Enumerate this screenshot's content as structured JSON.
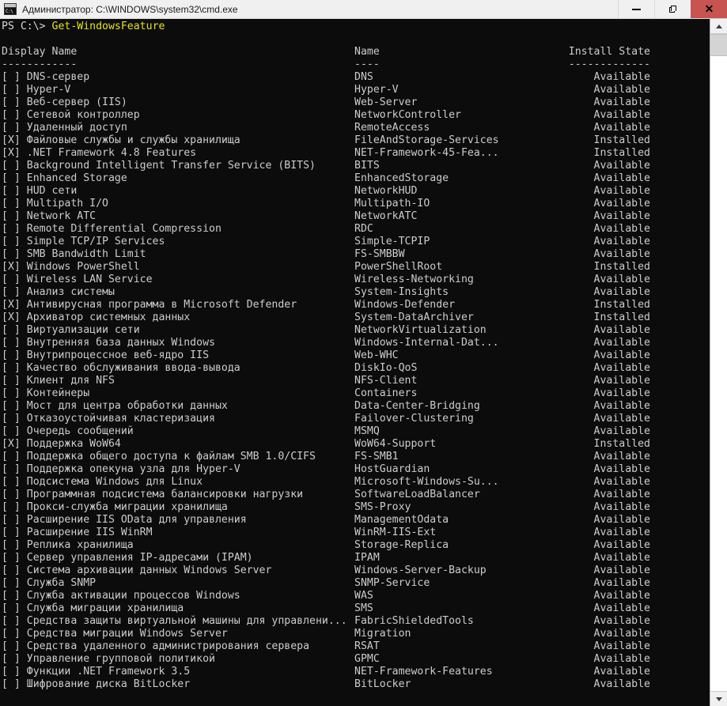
{
  "window": {
    "title": "Администратор: C:\\WINDOWS\\system32\\cmd.exe",
    "icon": "cmd-console-icon",
    "icon_text": "C:\\",
    "colors": {
      "titlebar_bg": "#f0f0f0",
      "close_bg": "#c75450",
      "console_bg": "#0c0c0c",
      "console_fg": "#cccccc",
      "prompt_command_fg": "#e5e510"
    },
    "buttons": {
      "minimize": "minimize-button",
      "maximize": "restore-button",
      "close": "close-button",
      "close_label": "✕"
    }
  },
  "console": {
    "prompt_prefix": "PS C:\\> ",
    "command": "Get-WindowsFeature",
    "headers": {
      "display_name": "Display Name",
      "name": "Name",
      "install_state": "Install State"
    },
    "rules": {
      "display_name": "------------",
      "name": "----",
      "install_state": "-------------"
    },
    "rows": [
      {
        "mark": "[ ]",
        "display": "DNS-сервер",
        "name": "DNS",
        "state": "Available"
      },
      {
        "mark": "[ ]",
        "display": "Hyper-V",
        "name": "Hyper-V",
        "state": "Available"
      },
      {
        "mark": "[ ]",
        "display": "Веб-сервер (IIS)",
        "name": "Web-Server",
        "state": "Available"
      },
      {
        "mark": "[ ]",
        "display": "Сетевой контроллер",
        "name": "NetworkController",
        "state": "Available"
      },
      {
        "mark": "[ ]",
        "display": "Удаленный доступ",
        "name": "RemoteAccess",
        "state": "Available"
      },
      {
        "mark": "[X]",
        "display": "Файловые службы и службы хранилища",
        "name": "FileAndStorage-Services",
        "state": "Installed"
      },
      {
        "mark": "[X]",
        "display": ".NET Framework 4.8 Features",
        "name": "NET-Framework-45-Fea...",
        "state": "Installed"
      },
      {
        "mark": "[ ]",
        "display": "Background Intelligent Transfer Service (BITS)",
        "name": "BITS",
        "state": "Available"
      },
      {
        "mark": "[ ]",
        "display": "Enhanced Storage",
        "name": "EnhancedStorage",
        "state": "Available"
      },
      {
        "mark": "[ ]",
        "display": "HUD сети",
        "name": "NetworkHUD",
        "state": "Available"
      },
      {
        "mark": "[ ]",
        "display": "Multipath I/O",
        "name": "Multipath-IO",
        "state": "Available"
      },
      {
        "mark": "[ ]",
        "display": "Network ATC",
        "name": "NetworkATC",
        "state": "Available"
      },
      {
        "mark": "[ ]",
        "display": "Remote Differential Compression",
        "name": "RDC",
        "state": "Available"
      },
      {
        "mark": "[ ]",
        "display": "Simple TCP/IP Services",
        "name": "Simple-TCPIP",
        "state": "Available"
      },
      {
        "mark": "[ ]",
        "display": "SMB Bandwidth Limit",
        "name": "FS-SMBBW",
        "state": "Available"
      },
      {
        "mark": "[X]",
        "display": "Windows PowerShell",
        "name": "PowerShellRoot",
        "state": "Installed"
      },
      {
        "mark": "[ ]",
        "display": "Wireless LAN Service",
        "name": "Wireless-Networking",
        "state": "Available"
      },
      {
        "mark": "[ ]",
        "display": "Анализ системы",
        "name": "System-Insights",
        "state": "Available"
      },
      {
        "mark": "[X]",
        "display": "Антивирусная программа в Microsoft Defender",
        "name": "Windows-Defender",
        "state": "Installed"
      },
      {
        "mark": "[X]",
        "display": "Архиватор системных данных",
        "name": "System-DataArchiver",
        "state": "Installed"
      },
      {
        "mark": "[ ]",
        "display": "Виртуализации сети",
        "name": "NetworkVirtualization",
        "state": "Available"
      },
      {
        "mark": "[ ]",
        "display": "Внутренняя база данных Windows",
        "name": "Windows-Internal-Dat...",
        "state": "Available"
      },
      {
        "mark": "[ ]",
        "display": "Внутрипроцессное веб-ядро IIS",
        "name": "Web-WHC",
        "state": "Available"
      },
      {
        "mark": "[ ]",
        "display": "Качество обслуживания ввода-вывода",
        "name": "DiskIo-QoS",
        "state": "Available"
      },
      {
        "mark": "[ ]",
        "display": "Клиент для NFS",
        "name": "NFS-Client",
        "state": "Available"
      },
      {
        "mark": "[ ]",
        "display": "Контейнеры",
        "name": "Containers",
        "state": "Available"
      },
      {
        "mark": "[ ]",
        "display": "Мост для центра обработки данных",
        "name": "Data-Center-Bridging",
        "state": "Available"
      },
      {
        "mark": "[ ]",
        "display": "Отказоустойчивая кластеризация",
        "name": "Failover-Clustering",
        "state": "Available"
      },
      {
        "mark": "[ ]",
        "display": "Очередь сообщений",
        "name": "MSMQ",
        "state": "Available"
      },
      {
        "mark": "[X]",
        "display": "Поддержка WoW64",
        "name": "WoW64-Support",
        "state": "Installed"
      },
      {
        "mark": "[ ]",
        "display": "Поддержка общего доступа к файлам SMB 1.0/CIFS",
        "name": "FS-SMB1",
        "state": "Available"
      },
      {
        "mark": "[ ]",
        "display": "Поддержка опекуна узла для Hyper-V",
        "name": "HostGuardian",
        "state": "Available"
      },
      {
        "mark": "[ ]",
        "display": "Подсистема Windows для Linux",
        "name": "Microsoft-Windows-Su...",
        "state": "Available"
      },
      {
        "mark": "[ ]",
        "display": "Программная подсистема балансировки нагрузки",
        "name": "SoftwareLoadBalancer",
        "state": "Available"
      },
      {
        "mark": "[ ]",
        "display": "Прокси-служба миграции хранилища",
        "name": "SMS-Proxy",
        "state": "Available"
      },
      {
        "mark": "[ ]",
        "display": "Расширение IIS OData для управления",
        "name": "ManagementOdata",
        "state": "Available"
      },
      {
        "mark": "[ ]",
        "display": "Расширение IIS WinRM",
        "name": "WinRM-IIS-Ext",
        "state": "Available"
      },
      {
        "mark": "[ ]",
        "display": "Реплика хранилища",
        "name": "Storage-Replica",
        "state": "Available"
      },
      {
        "mark": "[ ]",
        "display": "Сервер управления IP-адресами (IPAM)",
        "name": "IPAM",
        "state": "Available"
      },
      {
        "mark": "[ ]",
        "display": "Система архивации данных Windows Server",
        "name": "Windows-Server-Backup",
        "state": "Available"
      },
      {
        "mark": "[ ]",
        "display": "Служба SNMP",
        "name": "SNMP-Service",
        "state": "Available"
      },
      {
        "mark": "[ ]",
        "display": "Служба активации процессов Windows",
        "name": "WAS",
        "state": "Available"
      },
      {
        "mark": "[ ]",
        "display": "Служба миграции хранилища",
        "name": "SMS",
        "state": "Available"
      },
      {
        "mark": "[ ]",
        "display": "Средства защиты виртуальной машины для управлени...",
        "name": "FabricShieldedTools",
        "state": "Available"
      },
      {
        "mark": "[ ]",
        "display": "Средства миграции Windows Server",
        "name": "Migration",
        "state": "Available"
      },
      {
        "mark": "[ ]",
        "display": "Средства удаленного администрирования сервера",
        "name": "RSAT",
        "state": "Available"
      },
      {
        "mark": "[ ]",
        "display": "Управление групповой политикой",
        "name": "GPMC",
        "state": "Available"
      },
      {
        "mark": "[ ]",
        "display": "Функции .NET Framework 3.5",
        "name": "NET-Framework-Features",
        "state": "Available"
      },
      {
        "mark": "[ ]",
        "display": "Шифрование диска BitLocker",
        "name": "BitLocker",
        "state": "Available"
      }
    ]
  },
  "scrollbar": {
    "up_arrow": "scroll-up-arrow-icon",
    "down_arrow": "scroll-down-arrow-icon"
  }
}
